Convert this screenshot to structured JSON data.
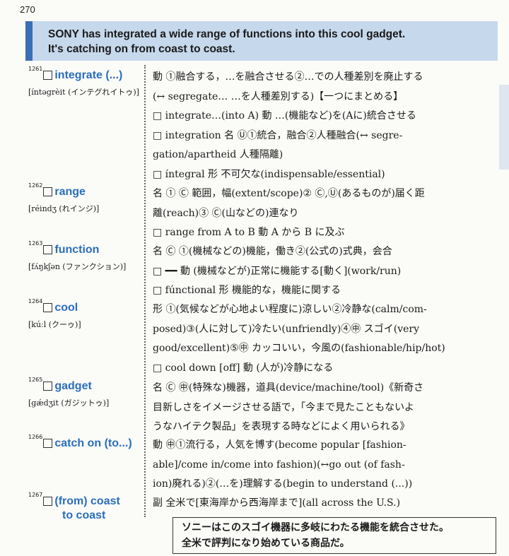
{
  "page_number": "270",
  "header": {
    "line1": "SONY has integrated a wide range of functions into this cool gadget.",
    "line2": "It's catching on from coast to coast."
  },
  "entries": [
    {
      "num": "1261",
      "word": "integrate (...)",
      "pron": "[íntəgrèit (インテグれイトゥ)]",
      "lines": [
        "動 ①融合する，…を融合させる②…での人種差別を廃止する",
        "(↔ segregate… …を人種差別する)【一つにまとめる】",
        "□ integrate…(into A) 動 …(機能など)を(Aに)統合させる",
        "□ integration 名 Ⓤ①統合，融合②人種融合(↔ segre-",
        "gation/apartheid 人種隔離)",
        "□ íntegral 形 不可欠な(indispensable/essential)"
      ]
    },
    {
      "num": "1262",
      "word": "range",
      "pron": "[réindʒ (れインジ)]",
      "lines": [
        "名 ① Ⓒ 範囲，幅(extent/scope)② Ⓒ,Ⓤ(あるものが)届く距",
        "離(reach)③ Ⓒ(山などの)連なり",
        "□ range from A to B 動 A から B に及ぶ"
      ]
    },
    {
      "num": "1263",
      "word": "function",
      "pron": "[fʌ́ŋkʃən (ファンクション)]",
      "lines": [
        "名 Ⓒ ①(機械などの)機能，働き②(公式の)式典，会合",
        "□ ━━ 動 (機械などが)正常に機能する[動く](work/run)",
        "□ fúnctional 形 機能的な，機能に関する"
      ]
    },
    {
      "num": "1264",
      "word": "cool",
      "pron": "[kúːl (クーゥ)]",
      "lines": [
        "形 ①(気候などが心地よい程度に)涼しい②冷静な(calm/com-",
        "posed)③(人に対して)冷たい(unfriendly)④㊥ スゴイ(very",
        "good/excellent)⑤㊥ カッコいい，今風の(fashionable/hip/hot)",
        "□ cool down [off] 動 (人が)冷静になる"
      ]
    },
    {
      "num": "1265",
      "word": "gadget",
      "pron": "[gǽdʒit (ガジットゥ)]",
      "lines": [
        "名 Ⓒ ㊥(特殊な)機器，道具(device/machine/tool)《新奇さ",
        "目新しさをイメージさせる語で，「今まで見たこともないよ",
        "うなハイテク製品」を表現する時などによく用いられる》"
      ]
    },
    {
      "num": "1266",
      "word": "catch on (to...)",
      "pron": "",
      "lines": [
        "動 ㊥①流行る，人気を博す(become popular [fashion-",
        "able]/come in/come into fashion)(↔go out (of fash-",
        "ion)廃れる)②(…を)理解する(begin to understand (...))"
      ]
    },
    {
      "num": "1267",
      "word": "(from) coast",
      "word2": "to coast",
      "pron": "",
      "lines": [
        "副 全米で[東海岸から西海岸まで](all across the U.S.)"
      ]
    }
  ],
  "note": {
    "line1": "ソニーはこのスゴイ機器に多岐にわたる機能を統合させた。",
    "line2": "全米で評判になり始めている商品だ。"
  }
}
